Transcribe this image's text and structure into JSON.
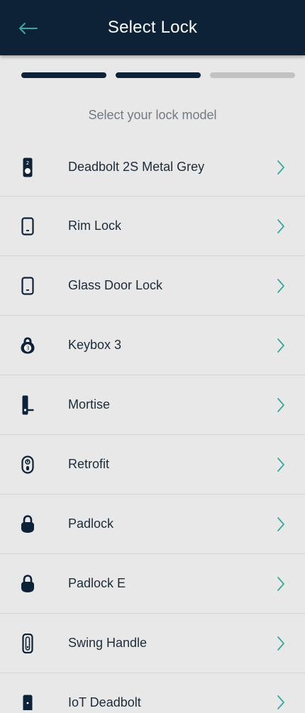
{
  "header": {
    "title": "Select Lock",
    "back_icon": "arrow-left-icon"
  },
  "progress": {
    "step": 2,
    "total": 3,
    "active_color": "#0d2237",
    "inactive_color": "#c2c2c2"
  },
  "subtitle": "Select your lock model",
  "colors": {
    "header_bg": "#0d2237",
    "accent": "#3aa89c"
  },
  "locks": [
    {
      "label": "Deadbolt 2S Metal Grey",
      "icon": "deadbolt-2s-icon"
    },
    {
      "label": "Rim Lock",
      "icon": "rim-lock-icon"
    },
    {
      "label": "Glass Door Lock",
      "icon": "glass-door-lock-icon"
    },
    {
      "label": "Keybox 3",
      "icon": "keybox-icon"
    },
    {
      "label": "Mortise",
      "icon": "mortise-icon"
    },
    {
      "label": "Retrofit",
      "icon": "retrofit-icon"
    },
    {
      "label": "Padlock",
      "icon": "padlock-icon"
    },
    {
      "label": "Padlock E",
      "icon": "padlock-e-icon"
    },
    {
      "label": "Swing Handle",
      "icon": "swing-handle-icon"
    },
    {
      "label": "IoT Deadbolt",
      "icon": "iot-deadbolt-icon"
    }
  ]
}
